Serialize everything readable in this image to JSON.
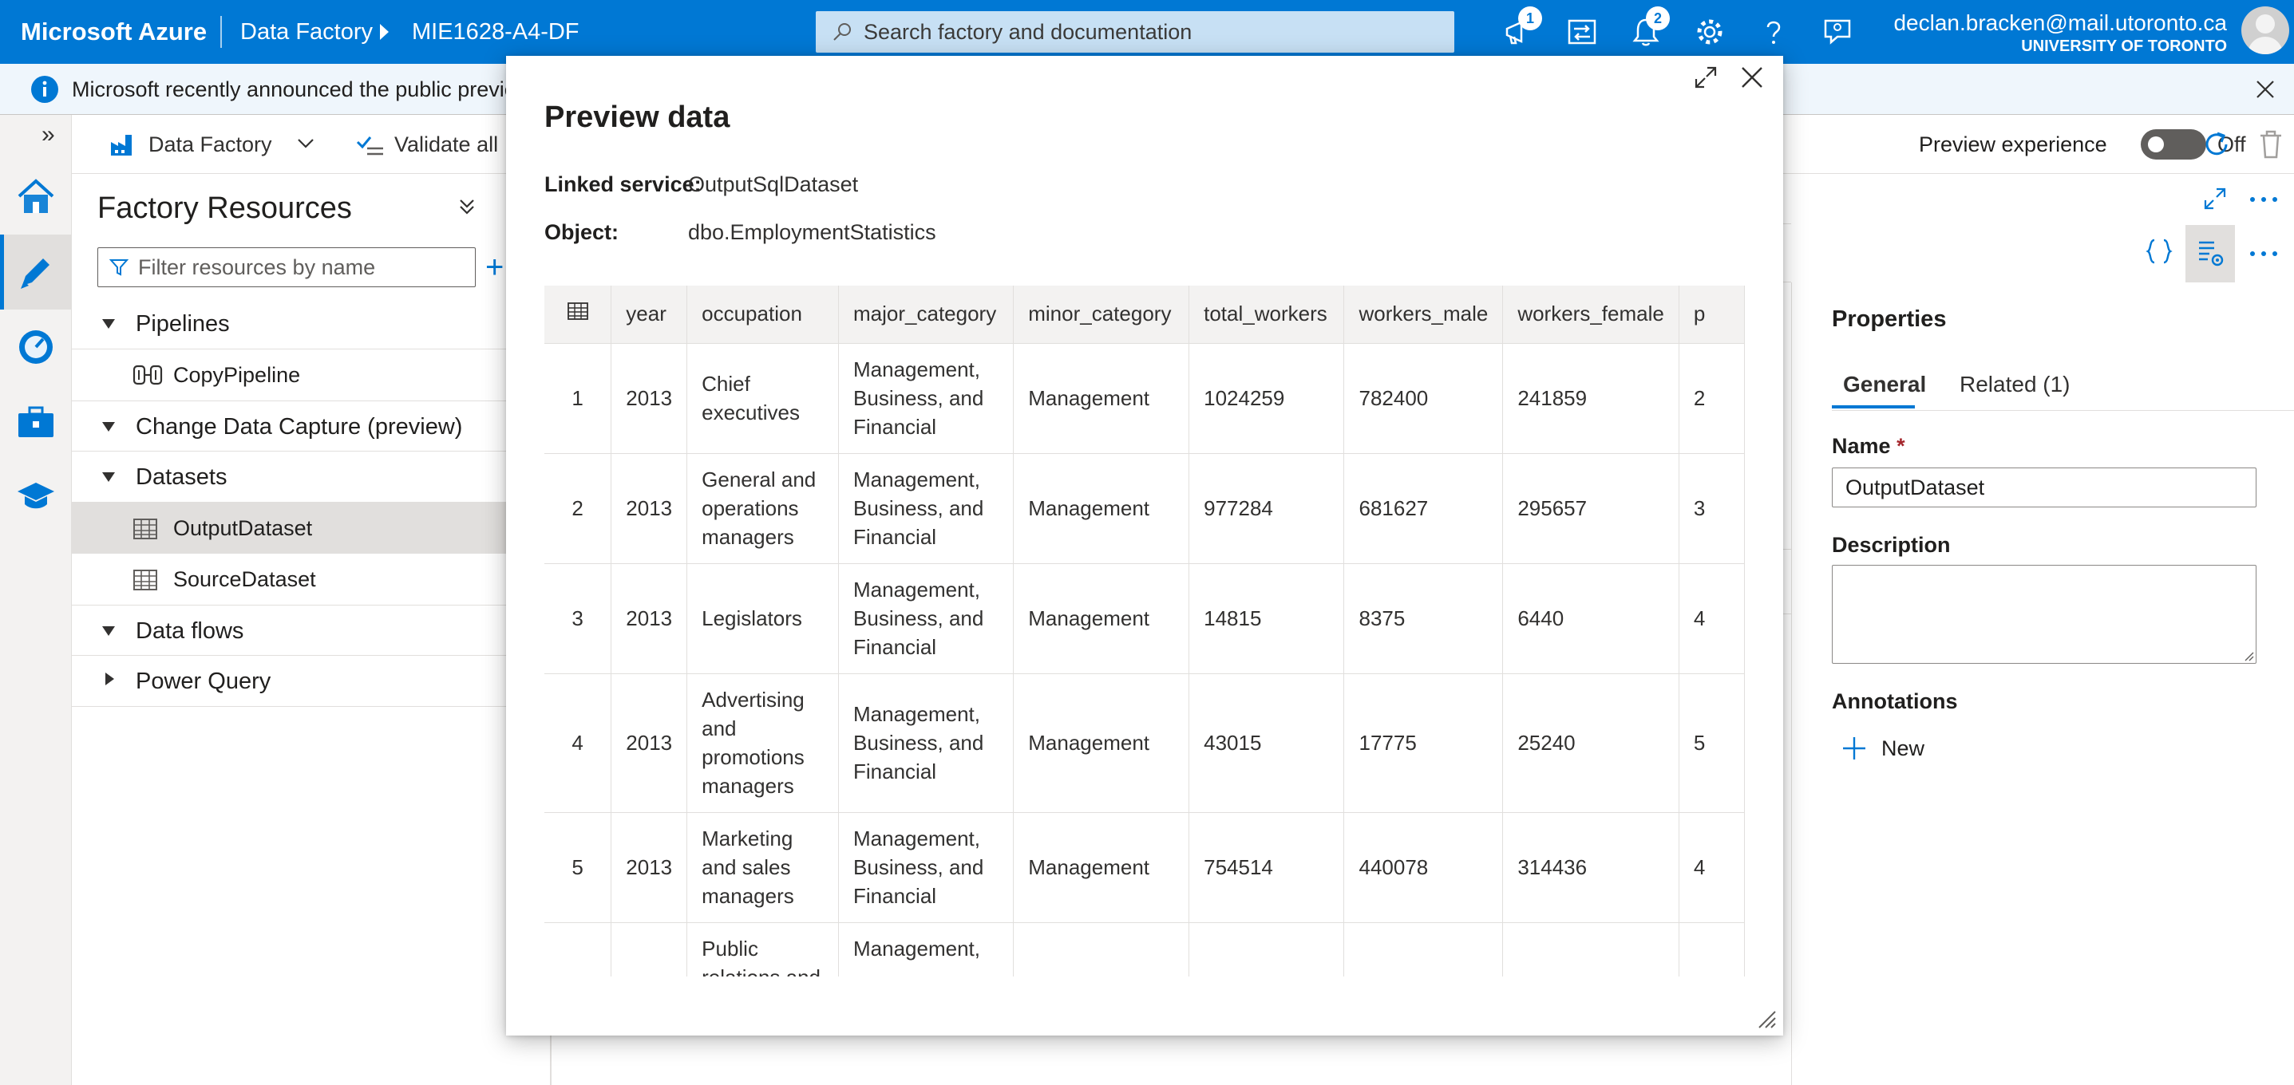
{
  "header": {
    "brand": "Microsoft Azure",
    "service": "Data Factory",
    "factory_name": "MIE1628-A4-DF",
    "search_placeholder": "Search factory and documentation",
    "announcements_badge": "1",
    "notifications_badge": "2",
    "user_email": "declan.bracken@mail.utoronto.ca",
    "user_org": "UNIVERSITY OF TORONTO"
  },
  "banner": {
    "text": "Microsoft recently announced the public preview"
  },
  "toolbar": {
    "data_factory_label": "Data Factory",
    "validate_all_label": "Validate all",
    "preview_experience_label": "Preview experience",
    "toggle_state": "Off"
  },
  "factory_resources": {
    "title": "Factory Resources",
    "filter_placeholder": "Filter resources by name",
    "sections": [
      {
        "label": "Pipelines"
      },
      {
        "label": "Change Data Capture (preview)"
      },
      {
        "label": "Datasets"
      },
      {
        "label": "Data flows"
      },
      {
        "label": "Power Query"
      }
    ],
    "pipelines": [
      {
        "label": "CopyPipeline"
      }
    ],
    "datasets": [
      {
        "label": "OutputDataset"
      },
      {
        "label": "SourceDataset"
      }
    ]
  },
  "properties": {
    "title": "Properties",
    "tabs": [
      {
        "label": "General"
      },
      {
        "label": "Related (1)"
      }
    ],
    "name_label": "Name",
    "required_marker": "*",
    "name_value": "OutputDataset",
    "description_label": "Description",
    "annotations_label": "Annotations",
    "new_label": "New"
  },
  "preview": {
    "title": "Preview data",
    "linked_service_label": "Linked service:",
    "linked_service_value": "OutputSqlDataset",
    "object_label": "Object:",
    "object_value": "dbo.EmploymentStatistics",
    "columns": [
      "year",
      "occupation",
      "major_category",
      "minor_category",
      "total_workers",
      "workers_male",
      "workers_female",
      "p"
    ],
    "rows": [
      {
        "index": "1",
        "year": "2013",
        "occupation": "Chief executives",
        "major_category": "Management, Business, and Financial",
        "minor_category": "Management",
        "total_workers": "1024259",
        "workers_male": "782400",
        "workers_female": "241859",
        "p": "2"
      },
      {
        "index": "2",
        "year": "2013",
        "occupation": "General and operations managers",
        "major_category": "Management, Business, and Financial",
        "minor_category": "Management",
        "total_workers": "977284",
        "workers_male": "681627",
        "workers_female": "295657",
        "p": "3"
      },
      {
        "index": "3",
        "year": "2013",
        "occupation": "Legislators",
        "major_category": "Management, Business, and Financial",
        "minor_category": "Management",
        "total_workers": "14815",
        "workers_male": "8375",
        "workers_female": "6440",
        "p": "4"
      },
      {
        "index": "4",
        "year": "2013",
        "occupation": "Advertising and promotions managers",
        "major_category": "Management, Business, and Financial",
        "minor_category": "Management",
        "total_workers": "43015",
        "workers_male": "17775",
        "workers_female": "25240",
        "p": "5"
      },
      {
        "index": "5",
        "year": "2013",
        "occupation": "Marketing and sales managers",
        "major_category": "Management, Business, and Financial",
        "minor_category": "Management",
        "total_workers": "754514",
        "workers_male": "440078",
        "workers_female": "314436",
        "p": "4"
      },
      {
        "index": "",
        "year": "",
        "occupation": "Public relations and",
        "major_category": "Management,",
        "minor_category": "",
        "total_workers": "",
        "workers_male": "",
        "workers_female": "",
        "p": ""
      }
    ]
  },
  "colors": {
    "azure_blue": "#0078d4",
    "banner_bg": "#eff6fc",
    "search_bg": "#c7e0f4"
  }
}
